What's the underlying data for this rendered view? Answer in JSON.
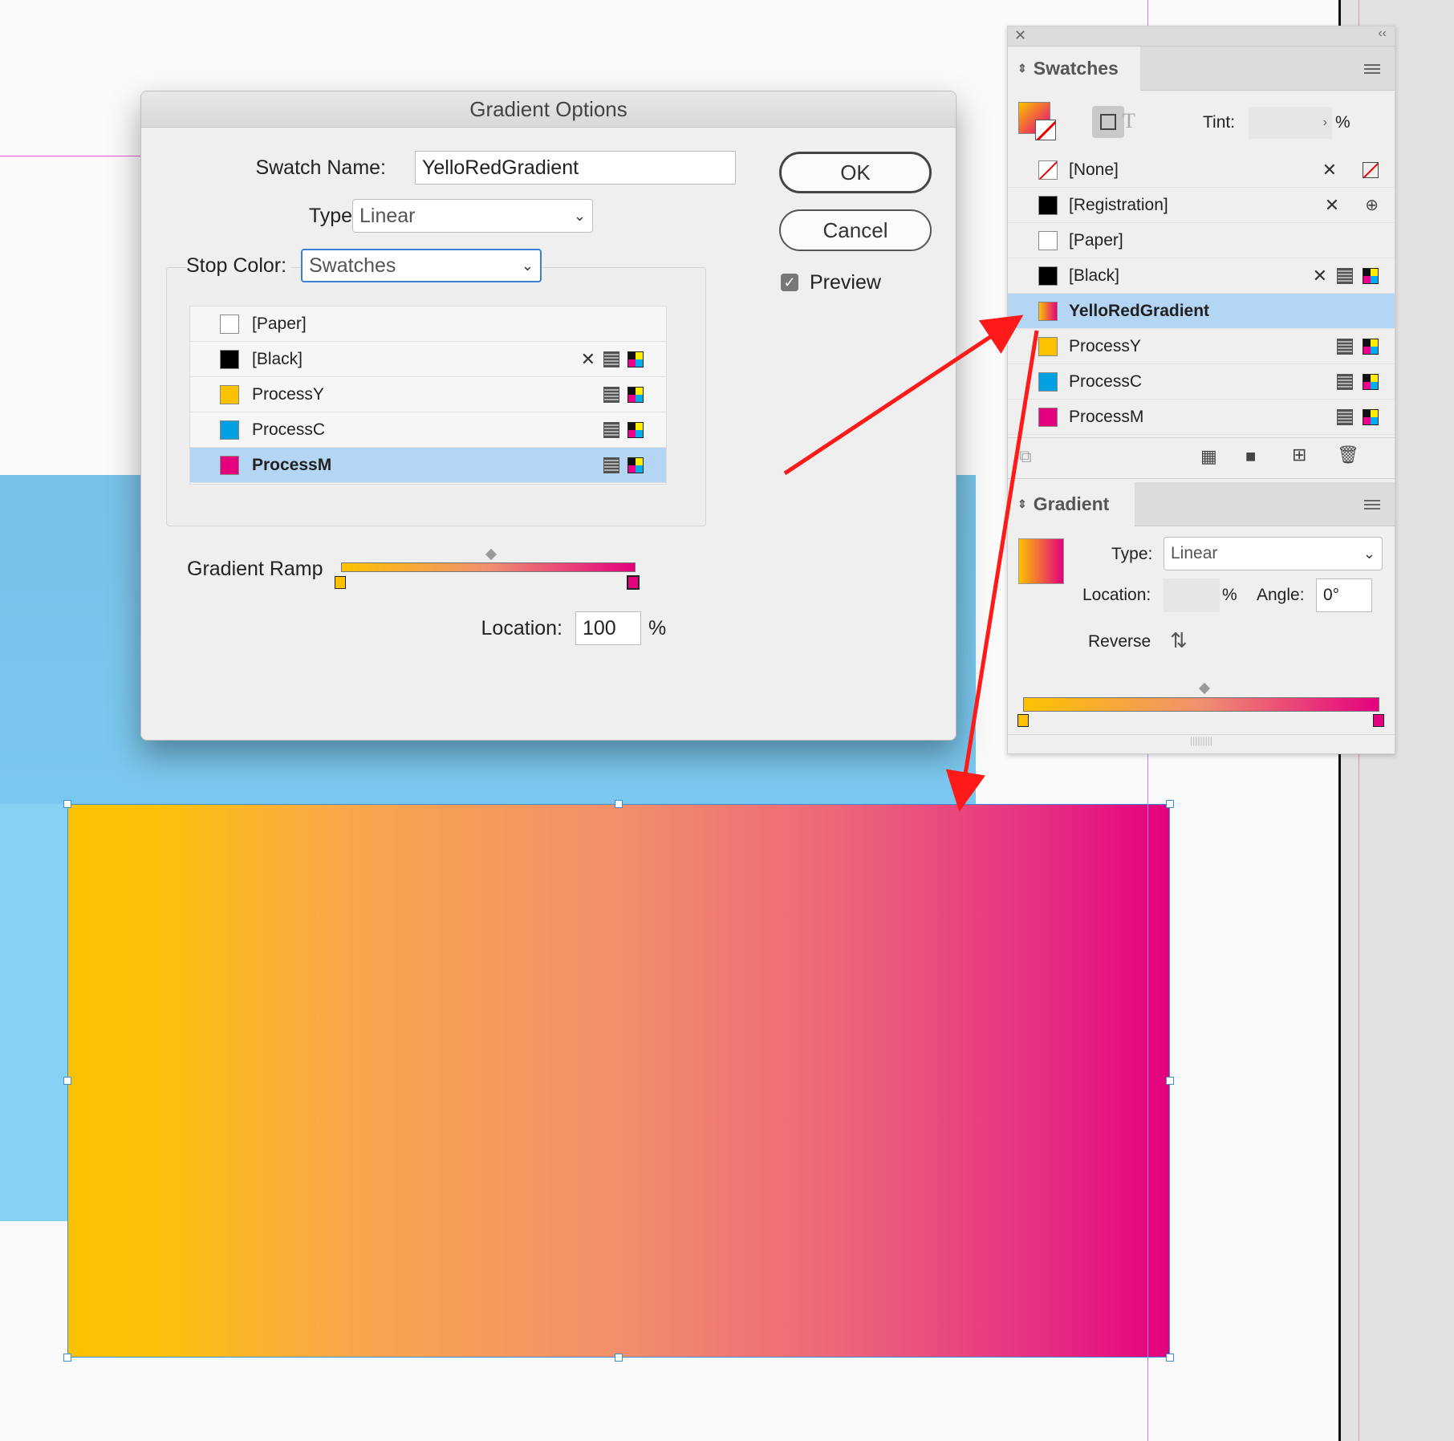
{
  "dialog": {
    "title": "Gradient Options",
    "swatch_name_label": "Swatch Name:",
    "swatch_name_value": "YelloRedGradient",
    "type_label": "Type:",
    "type_value": "Linear",
    "stop_color_label": "Stop Color:",
    "stop_color_value": "Swatches",
    "swatch_list": [
      {
        "name": "[Paper]",
        "color": "#ffffff",
        "icons": []
      },
      {
        "name": "[Black]",
        "color": "#000000",
        "icons": [
          "no-edit",
          "process",
          "cmyk"
        ]
      },
      {
        "name": "ProcessY",
        "color": "#fcc200",
        "icons": [
          "process",
          "cmyk"
        ]
      },
      {
        "name": "ProcessC",
        "color": "#00a0e3",
        "icons": [
          "process",
          "cmyk"
        ]
      },
      {
        "name": "ProcessM",
        "color": "#e4007f",
        "icons": [
          "process",
          "cmyk"
        ],
        "selected": true
      }
    ],
    "ok_label": "OK",
    "cancel_label": "Cancel",
    "preview_label": "Preview",
    "preview_checked": true,
    "gradient_ramp_label": "Gradient Ramp",
    "location_label": "Location:",
    "location_value": "100",
    "percent": "%"
  },
  "swatches_panel": {
    "tab_label": "Swatches",
    "tint_label": "Tint:",
    "tint_unit": "%",
    "items": [
      {
        "name": "[None]",
        "color": "none",
        "icons": [
          "no-edit",
          "none"
        ]
      },
      {
        "name": "[Registration]",
        "color": "#000000",
        "icons": [
          "no-edit",
          "registration"
        ]
      },
      {
        "name": "[Paper]",
        "color": "#ffffff",
        "icons": []
      },
      {
        "name": "[Black]",
        "color": "#000000",
        "icons": [
          "no-edit",
          "process",
          "cmyk"
        ]
      },
      {
        "name": "YelloRedGradient",
        "color": "gradient",
        "icons": [],
        "selected": true
      },
      {
        "name": "ProcessY",
        "color": "#fcc200",
        "icons": [
          "process",
          "cmyk"
        ]
      },
      {
        "name": "ProcessC",
        "color": "#00a0e3",
        "icons": [
          "process",
          "cmyk"
        ]
      },
      {
        "name": "ProcessM",
        "color": "#e4007f",
        "icons": [
          "process",
          "cmyk"
        ]
      }
    ]
  },
  "gradient_panel": {
    "tab_label": "Gradient",
    "type_label": "Type:",
    "type_value": "Linear",
    "location_label": "Location:",
    "location_unit": "%",
    "angle_label": "Angle:",
    "angle_value": "0°",
    "reverse_label": "Reverse"
  },
  "colors": {
    "gradient_start": "#fcc200",
    "gradient_end": "#e4007f",
    "selection_highlight": "#b5d5f5",
    "arrow": "#ff1a1a"
  }
}
